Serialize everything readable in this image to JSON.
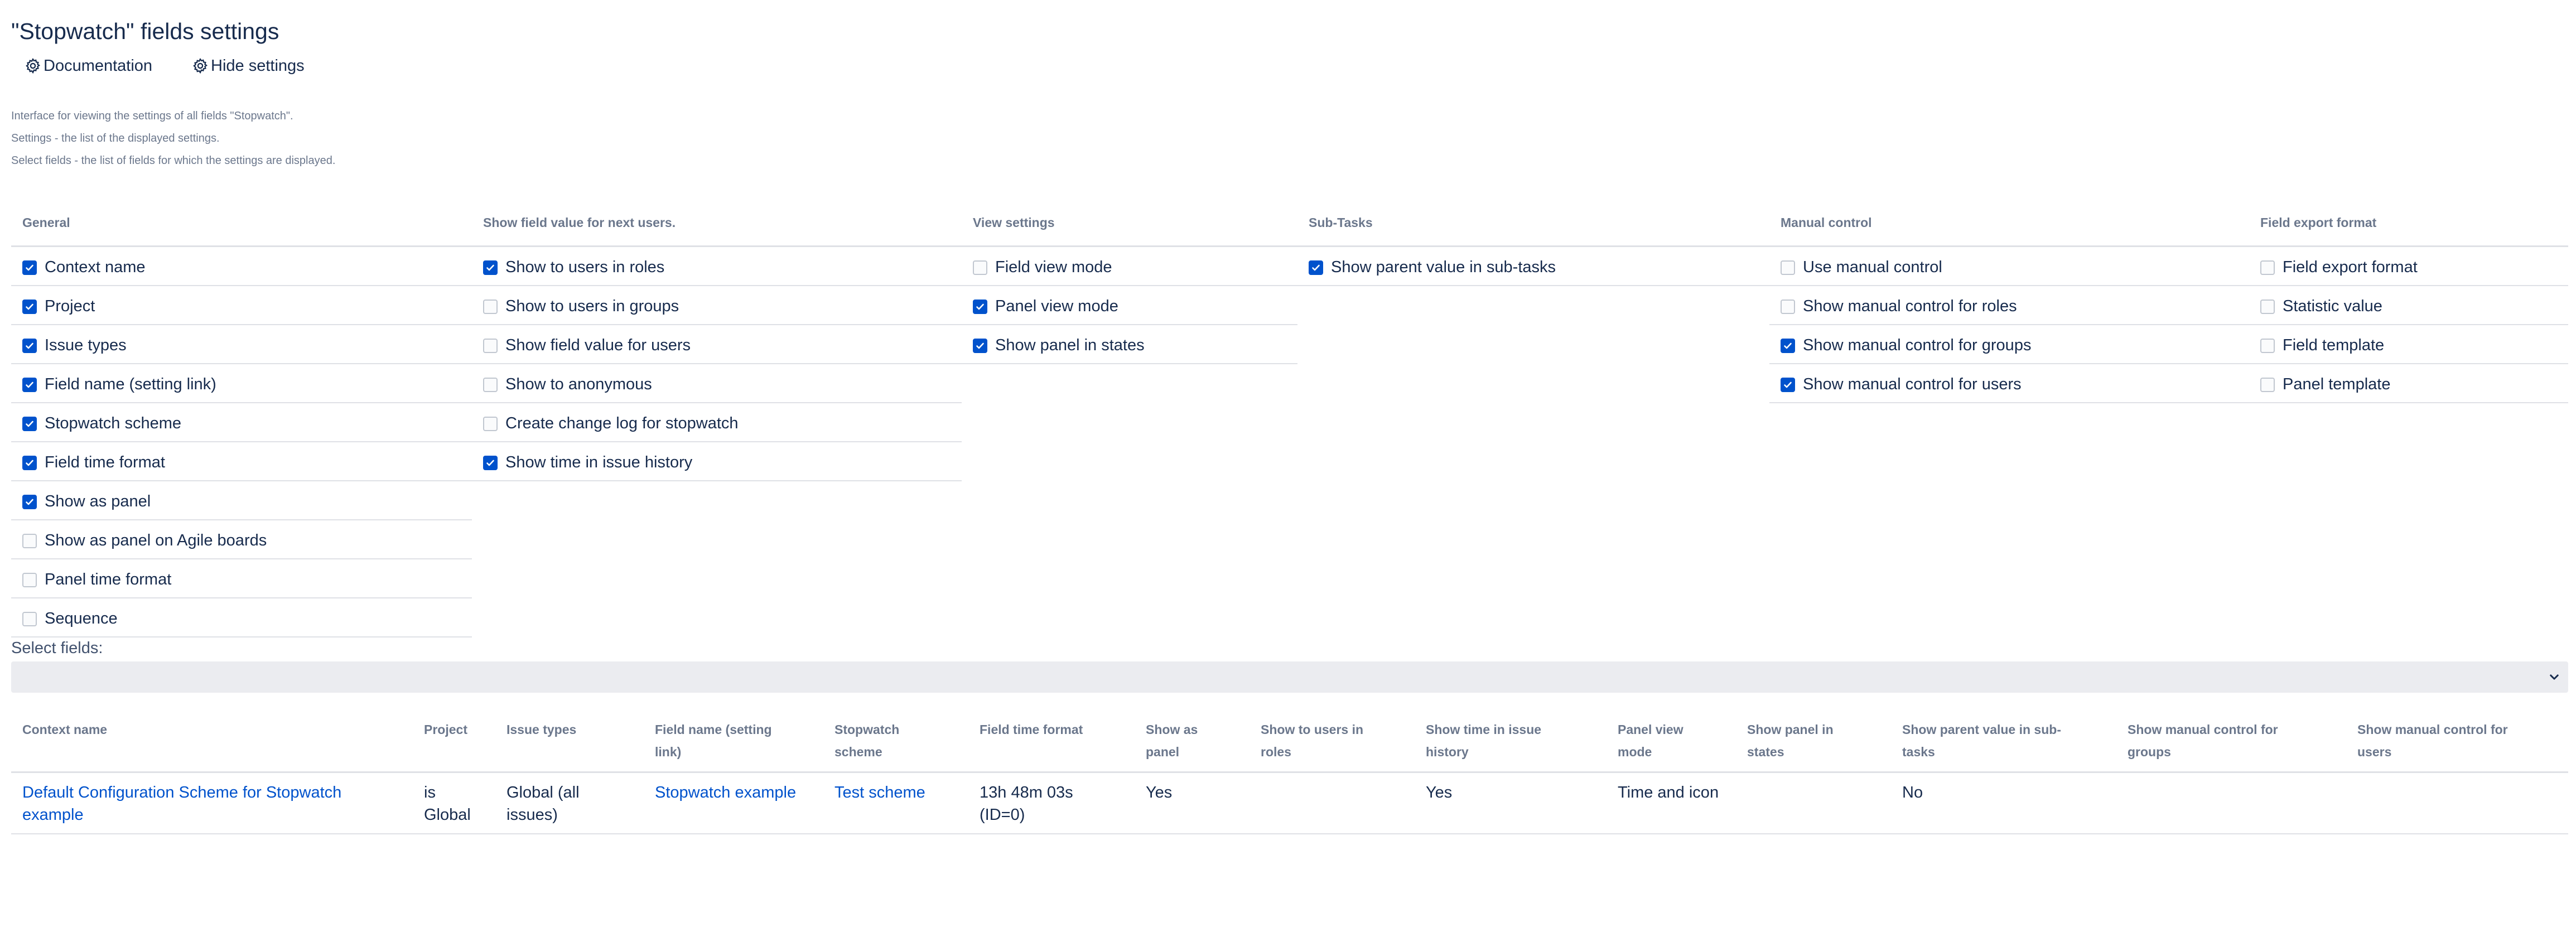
{
  "page": {
    "title": "\"Stopwatch\" fields settings",
    "toolbar": {
      "documentation_label": "Documentation",
      "hide_settings_label": "Hide settings"
    },
    "intro": [
      "Interface for viewing the settings of all fields \"Stopwatch\".",
      "Settings - the list of the displayed settings.",
      "Select fields - the list of fields for which the settings are displayed."
    ]
  },
  "settings": {
    "sections": [
      {
        "header": "General",
        "items": [
          {
            "label": "Context name",
            "checked": true
          },
          {
            "label": "Project",
            "checked": true
          },
          {
            "label": "Issue types",
            "checked": true
          },
          {
            "label": "Field name (setting link)",
            "checked": true
          },
          {
            "label": "Stopwatch scheme",
            "checked": true
          },
          {
            "label": "Field time format",
            "checked": true
          },
          {
            "label": "Show as panel",
            "checked": true
          },
          {
            "label": "Show as panel on Agile boards",
            "checked": false
          },
          {
            "label": "Panel time format",
            "checked": false
          },
          {
            "label": "Sequence",
            "checked": false
          }
        ]
      },
      {
        "header": "Show field value for next users.",
        "items": [
          {
            "label": "Show to users in roles",
            "checked": true
          },
          {
            "label": "Show to users in groups",
            "checked": false
          },
          {
            "label": "Show field value for users",
            "checked": false
          },
          {
            "label": "Show to anonymous",
            "checked": false
          },
          {
            "label": "Create change log for stopwatch",
            "checked": false
          },
          {
            "label": "Show time in issue history",
            "checked": true
          }
        ]
      },
      {
        "header": "View settings",
        "items": [
          {
            "label": "Field view mode",
            "checked": false
          },
          {
            "label": "Panel view mode",
            "checked": true
          },
          {
            "label": "Show panel in states",
            "checked": true
          }
        ]
      },
      {
        "header": "Sub-Tasks",
        "items": [
          {
            "label": "Show parent value in sub-tasks",
            "checked": true
          }
        ]
      },
      {
        "header": "Manual control",
        "items": [
          {
            "label": "Use manual control",
            "checked": false
          },
          {
            "label": "Show manual control for roles",
            "checked": false
          },
          {
            "label": "Show manual control for groups",
            "checked": true
          },
          {
            "label": "Show manual control for users",
            "checked": true
          }
        ]
      },
      {
        "header": "Field export format",
        "items": [
          {
            "label": "Field export format",
            "checked": false
          },
          {
            "label": "Statistic value",
            "checked": false
          },
          {
            "label": "Field template",
            "checked": false
          },
          {
            "label": "Panel template",
            "checked": false
          }
        ]
      }
    ]
  },
  "select_fields": {
    "label": "Select fields:",
    "value": ""
  },
  "table": {
    "headers": [
      [
        "Context name"
      ],
      [
        "Project"
      ],
      [
        "Issue types"
      ],
      [
        "Field name (setting",
        "link)"
      ],
      [
        "Stopwatch",
        "scheme"
      ],
      [
        "Field time format"
      ],
      [
        "Show as",
        "panel"
      ],
      [
        "Show to users in",
        "roles"
      ],
      [
        "Show time in issue",
        "history"
      ],
      [
        "Panel view",
        "mode"
      ],
      [
        "Show panel in",
        "states"
      ],
      [
        "Show parent value in sub-",
        "tasks"
      ],
      [
        "Show manual control for",
        "groups"
      ],
      [
        "Show manual control for",
        "users"
      ]
    ],
    "rows": [
      {
        "cells": [
          [
            "Default Configuration Scheme for Stopwatch",
            "example"
          ],
          [
            "is",
            "Global"
          ],
          [
            "Global (all",
            "issues)"
          ],
          [
            "Stopwatch example"
          ],
          [
            "Test scheme"
          ],
          [
            "13h 48m 03s",
            "(ID=0)"
          ],
          [
            "Yes"
          ],
          [
            ""
          ],
          [
            "Yes"
          ],
          [
            "Time and icon"
          ],
          [
            ""
          ],
          [
            "No"
          ],
          [
            ""
          ],
          [
            ""
          ]
        ]
      }
    ]
  },
  "colors": {
    "accent": "#0052cc",
    "text": "#172b4d",
    "muted": "#6b778c",
    "border": "#dfe1e6",
    "select_bg": "#ebecf0"
  },
  "icons": {
    "documentation": "gear-icon",
    "hide_settings": "gear-icon",
    "select": "chevron-down-icon",
    "checkbox": "check-icon"
  }
}
